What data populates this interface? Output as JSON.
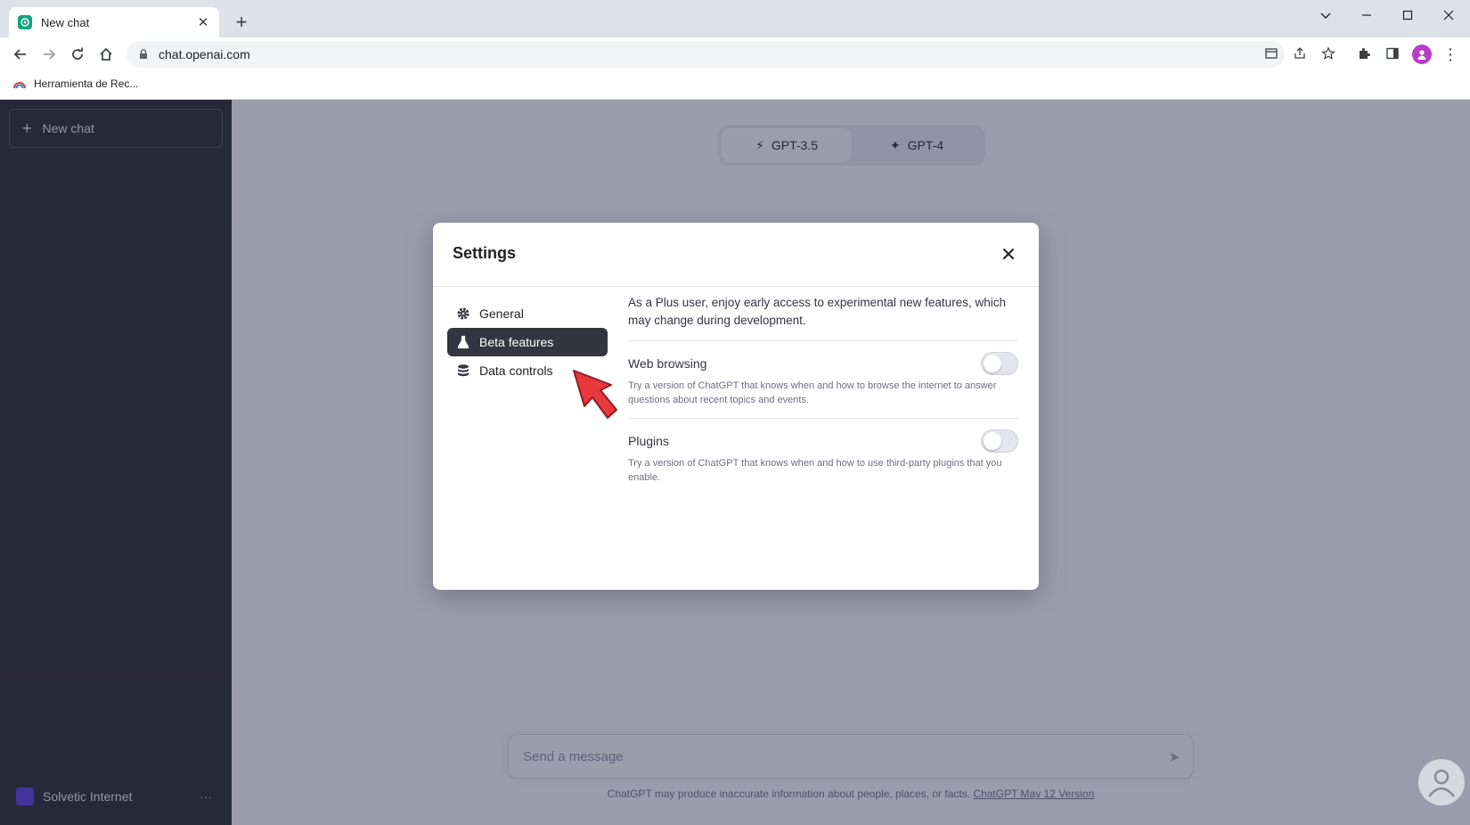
{
  "browser": {
    "tab": {
      "title": "New chat",
      "favicon": "openai-icon"
    },
    "new_tab": "+",
    "window_controls": [
      "chevron-down-icon",
      "minimize-icon",
      "maximize-icon",
      "close-icon"
    ],
    "url": "chat.openai.com",
    "bookmark": {
      "label": "Herramienta de Rec...",
      "icon": "bookmark-favicon"
    }
  },
  "sidebar": {
    "new_chat": "New chat",
    "user_name": "Solvetic Internet",
    "user_menu": "···"
  },
  "main": {
    "models": [
      {
        "label": "GPT-3.5",
        "icon": "bolt-icon"
      },
      {
        "label": "GPT-4",
        "icon": "sparkle-icon"
      }
    ],
    "composer_placeholder": "Send a message",
    "disclaimer": "ChatGPT may produce inaccurate information about people, places, or facts.",
    "disclaimer_link": "ChatGPT May 12 Version"
  },
  "settings": {
    "title": "Settings",
    "nav": [
      {
        "label": "General",
        "icon": "gear-icon",
        "active": false
      },
      {
        "label": "Beta features",
        "icon": "flask-icon",
        "active": true
      },
      {
        "label": "Data controls",
        "icon": "database-icon",
        "active": false
      }
    ],
    "intro": "As a Plus user, enjoy early access to experimental new features, which may change during development.",
    "features": [
      {
        "name": "Web browsing",
        "description": "Try a version of ChatGPT that knows when and how to browse the internet to answer questions about recent topics and events.",
        "enabled": false
      },
      {
        "name": "Plugins",
        "description": "Try a version of ChatGPT that knows when and how to use third-party plugins that you enable.",
        "enabled": false
      }
    ]
  },
  "colors": {
    "active_nav": "#343541",
    "overlay": "#323055",
    "pointer": "#e8383d",
    "brand": "#10a37f"
  }
}
